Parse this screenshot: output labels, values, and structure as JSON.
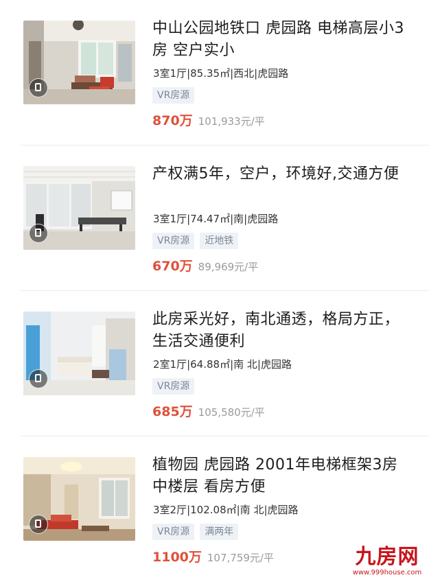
{
  "listings": [
    {
      "title": "中山公园地铁口 虎园路 电梯高层小3房 空户实小",
      "meta": "3室1厅|85.35㎡|西北|虎园路",
      "tags": [
        "VR房源"
      ],
      "price": "870万",
      "unit_price": "101,933元/平",
      "thumb_icon": "living-room-photo"
    },
    {
      "title": "产权满5年，空户，环境好,交通方便",
      "meta": "3室1厅|74.47㎡|南|虎园路",
      "tags": [
        "VR房源",
        "近地铁"
      ],
      "price": "670万",
      "unit_price": "89,969元/平",
      "thumb_icon": "office-room-photo"
    },
    {
      "title": "此房采光好，南北通透，格局方正，生活交通便利",
      "meta": "2室1厅|64.88㎡|南 北|虎园路",
      "tags": [
        "VR房源"
      ],
      "price": "685万",
      "unit_price": "105,580元/平",
      "thumb_icon": "bright-living-room-photo"
    },
    {
      "title": "植物园 虎园路 2001年电梯框架3房 中楼层 看房方便",
      "meta": "3室2厅|102.08㎡|南 北|虎园路",
      "tags": [
        "VR房源",
        "满两年"
      ],
      "price": "1100万",
      "unit_price": "107,759元/平",
      "thumb_icon": "warm-living-room-photo"
    }
  ],
  "watermark": {
    "logo": "九房网",
    "url": "www.999house.com"
  },
  "colors": {
    "price": "#e0503a",
    "tag_text": "#7b8796",
    "tag_bg": "#eef2f6",
    "watermark": "#c8141c"
  }
}
